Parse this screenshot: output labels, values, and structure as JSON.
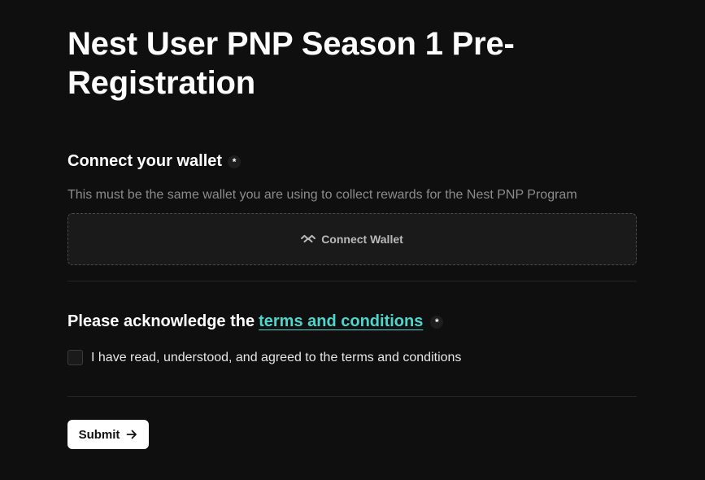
{
  "form": {
    "title": "Nest User PNP Season 1 Pre-Registration",
    "required_marker": "*",
    "wallet": {
      "label": "Connect your wallet",
      "helper": "This must be the same wallet you are using to collect rewards for the Nest PNP Program",
      "button_label": "Connect Wallet",
      "button_icon": "wallet-connect-icon"
    },
    "terms": {
      "label_prefix": "Please acknowledge the",
      "link_text": "terms and conditions",
      "checkbox_label": "I have read, understood, and agreed to the terms and conditions",
      "checked": false
    },
    "submit": {
      "label": "Submit",
      "icon": "arrow-right-icon"
    }
  },
  "colors": {
    "background": "#0f0f0f",
    "link": "#4fd6cc",
    "muted_text": "#8c8c8c",
    "button_bg": "#ffffff"
  }
}
